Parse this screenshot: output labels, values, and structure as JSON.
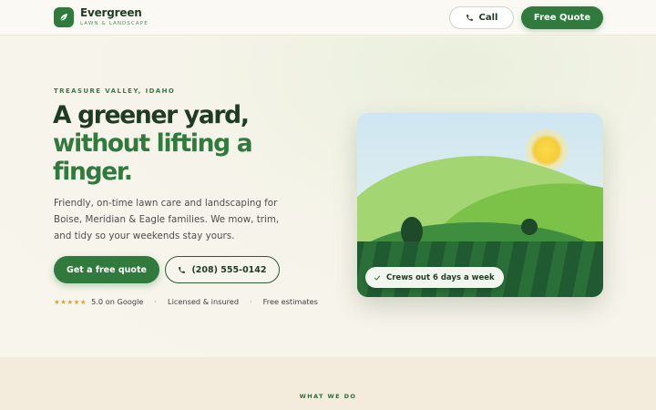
{
  "header": {
    "brand_name": "Evergreen",
    "brand_tag": "LAWN & LANDSCAPE",
    "call_label": "Call",
    "quote_label": "Free Quote"
  },
  "hero": {
    "eyebrow": "TREASURE VALLEY, IDAHO",
    "headline_line1": "A greener yard,",
    "headline_line2": "without lifting a",
    "headline_line3": "finger.",
    "lede": "Friendly, on-time lawn care and landscaping for Boise, Meridian & Eagle families. We mow, trim, and tidy so your weekends stay yours.",
    "primary_cta": "Get a free quote",
    "phone_cta": "(208) 555-0142",
    "trust": {
      "stars": "★★★★★",
      "rating": "5.0 on Google",
      "licensed": "Licensed & insured",
      "estimates": "Free estimates"
    },
    "card_badge": "Crews out 6 days a week"
  },
  "services": {
    "eyebrow": "WHAT WE DO"
  },
  "colors": {
    "brand_green": "#2f7a3c",
    "dark_green": "#1f3b24",
    "cream": "#f9f6ee",
    "star_gold": "#d9a53a"
  },
  "icons": [
    "leaf-icon",
    "phone-icon",
    "check-icon",
    "sun-icon"
  ]
}
